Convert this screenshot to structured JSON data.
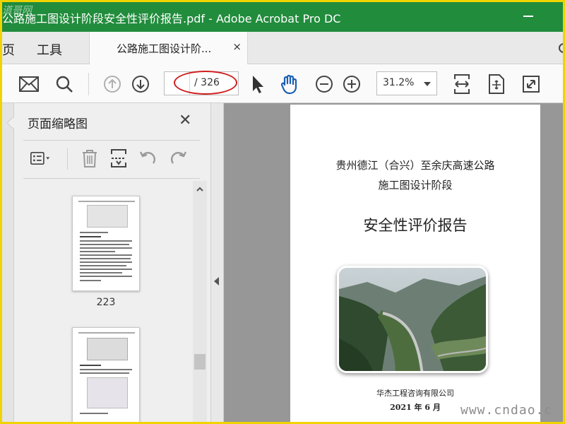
{
  "window": {
    "title": "公路施工图设计阶段安全性评价报告.pdf - Adobe Acrobat Pro DC",
    "watermark_logo": "道哥网"
  },
  "menu": {
    "home_partial": "页",
    "tools": "工具"
  },
  "tab": {
    "label": "公路施工图设计阶...",
    "close": "×"
  },
  "toolbar": {
    "page_current": "",
    "page_total": "/ 326",
    "zoom": "31.2%"
  },
  "thumbnail_panel": {
    "title": "页面缩略图",
    "close": "✕",
    "thumbnails": [
      {
        "page_label": "223"
      },
      {
        "page_label": ""
      }
    ]
  },
  "document": {
    "line1": "贵州德江（合兴）至余庆高速公路",
    "line2": "施工图设计阶段",
    "heading": "安全性评价报告",
    "company": "华杰工程咨询有限公司",
    "date": "2021 年 6 月"
  },
  "watermark_site": "www.cndao.c",
  "colors": {
    "titlebar": "#218c3c",
    "highlight_oval": "#d01c1c",
    "hand_tool": "#1a5fb4"
  }
}
